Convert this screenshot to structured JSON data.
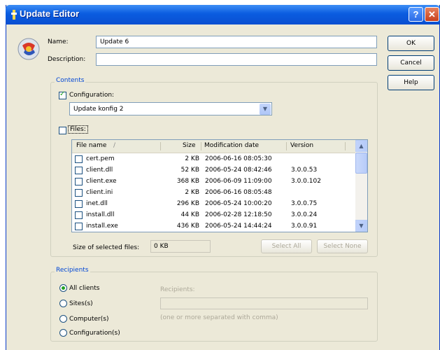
{
  "window": {
    "title": "Update Editor",
    "help_glyph": "?",
    "close_glyph": "✕"
  },
  "colors": {
    "titlebar": "#0A5CE0",
    "dialog_bg": "#ECE9D8",
    "group_title": "#0046D5",
    "check": "#21A121"
  },
  "form": {
    "name_label": "Name:",
    "name_value": "Update 6",
    "description_label": "Description:",
    "description_value": ""
  },
  "buttons": {
    "ok": "OK",
    "cancel": "Cancel",
    "help": "Help"
  },
  "contents": {
    "group_label": "Contents",
    "configuration_label": "Configuration:",
    "configuration_checked": true,
    "configuration_value": "Update konfig 2",
    "files_label": "Files:",
    "files_checked": false,
    "columns": {
      "name": "File name",
      "sort_glyph": "/",
      "size": "Size",
      "date": "Modification date",
      "version": "Version"
    },
    "files": [
      {
        "name": "cert.pem",
        "size": "2 KB",
        "date": "2006-06-16 08:05:30",
        "version": ""
      },
      {
        "name": "client.dll",
        "size": "52 KB",
        "date": "2006-05-24 08:42:46",
        "version": "3.0.0.53"
      },
      {
        "name": "client.exe",
        "size": "368 KB",
        "date": "2006-06-09 11:09:00",
        "version": "3.0.0.102"
      },
      {
        "name": "client.ini",
        "size": "2 KB",
        "date": "2006-06-16 08:05:48",
        "version": ""
      },
      {
        "name": "inet.dll",
        "size": "296 KB",
        "date": "2006-05-24 10:00:20",
        "version": "3.0.0.75"
      },
      {
        "name": "install.dll",
        "size": "44 KB",
        "date": "2006-02-28 12:18:50",
        "version": "3.0.0.24"
      },
      {
        "name": "install.exe",
        "size": "436 KB",
        "date": "2006-05-24 14:44:24",
        "version": "3.0.0.91"
      }
    ],
    "selected_size_label": "Size of selected files:",
    "selected_size_value": "0 KB",
    "select_all": "Select All",
    "select_none": "Select None"
  },
  "recipients": {
    "group_label": "Recipients",
    "options": [
      "All clients",
      "Sites(s)",
      "Computer(s)",
      "Configuration(s)"
    ],
    "selected": "All clients",
    "field_label": "Recipients:",
    "field_value": "",
    "hint": "(one or more separated with comma)"
  }
}
